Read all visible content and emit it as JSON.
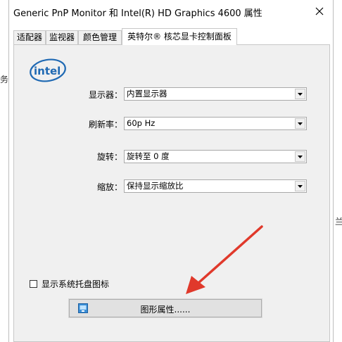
{
  "window": {
    "title": "Generic PnP Monitor 和 Intel(R) HD Graphics 4600 属性",
    "close_glyph": "✕"
  },
  "tabs": [
    {
      "label": "适配器",
      "active": false
    },
    {
      "label": "监视器",
      "active": false
    },
    {
      "label": "颜色管理",
      "active": false
    },
    {
      "label": "英特尔® 核芯显卡控制面板",
      "active": true
    }
  ],
  "logo": {
    "text": "intel",
    "color": "#1f69b3"
  },
  "settings": [
    {
      "label": "显示器：",
      "value": "内置显示器"
    },
    {
      "label": "刷新率：",
      "value": "60p Hz"
    },
    {
      "label": "旋转：",
      "value": "旋转至 0 度"
    },
    {
      "label": "缩放：",
      "value": "保持显示缩放比"
    }
  ],
  "tray_checkbox": {
    "label": "显示系统托盘图标",
    "checked": false
  },
  "graphics_button": {
    "label": "图形属性......"
  },
  "background": {
    "left_glyph": "务",
    "right_glyph": "兰"
  },
  "annotation": {
    "arrow_color": "#e0392b"
  }
}
